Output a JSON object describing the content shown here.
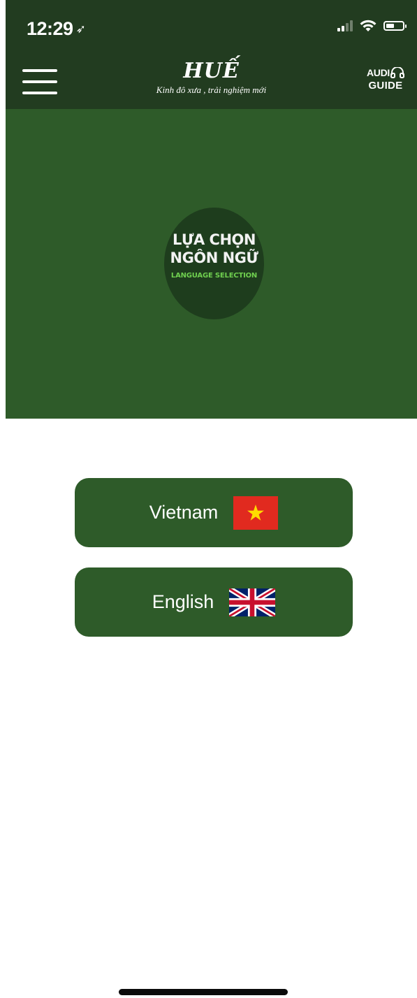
{
  "status_bar": {
    "time": "12:29",
    "location_glyph": "➶"
  },
  "header": {
    "title": "HUẾ",
    "subtitle": "Kinh đô xưa , trải nghiệm mới",
    "audio_guide": {
      "top": "AUDI",
      "bottom": "GUIDE"
    }
  },
  "hero": {
    "line1": "LỰA CHỌN",
    "line2": "NGÔN NGỮ",
    "line3": "LANGUAGE SELECTION"
  },
  "languages": [
    {
      "label": "Vietnam",
      "flag": "vietnam-flag-icon"
    },
    {
      "label": "English",
      "flag": "uk-flag-icon"
    }
  ],
  "colors": {
    "header_bg": "#223c20",
    "hero_bg": "#2e5b29",
    "circle_bg": "#1e3d1d",
    "accent_green": "#6fcf4f",
    "button_bg": "#2e5b29"
  }
}
